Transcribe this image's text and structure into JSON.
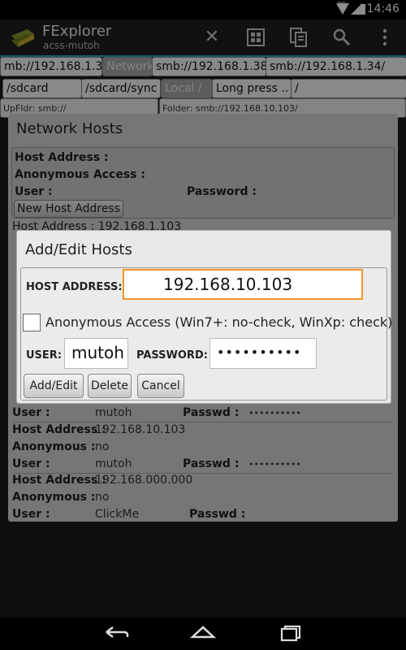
{
  "status": {
    "time": "14:46",
    "network": "3G"
  },
  "app": {
    "title": "FExplorer",
    "subtitle": "acss-mutoh"
  },
  "toolbar_icons": [
    "close-icon",
    "grid-icon",
    "copy-icon",
    "search-icon",
    "overflow-menu-icon"
  ],
  "tabs_row1": [
    {
      "label": "mb://192.168.1.34/"
    },
    {
      "label": "Network"
    },
    {
      "label": "smb://192.168.1.38/"
    },
    {
      "label": "smb://192.168.1.34/"
    }
  ],
  "tabs_row2": [
    {
      "label": "/sdcard"
    },
    {
      "label": "/sdcard/sync"
    },
    {
      "label": "Local /"
    },
    {
      "label": "Long press .."
    },
    {
      "label": "/"
    }
  ],
  "paths": {
    "up": "UpFldr: smb://",
    "folder": "Folder: smb://192.168.10.103/"
  },
  "network_hosts": {
    "title": "Network Hosts",
    "host_label": "Host Address :",
    "anon_label": "Anonymous Access :",
    "user_label": "User :",
    "password_label": "Password :",
    "new_host_button": "New Host Address",
    "first_host_partial": "Host Address :  192.168.1.103",
    "rows": [
      {
        "user_label": "User :",
        "user": "mutoh",
        "pass_label": "Passwd :",
        "pass": "••••••••••"
      },
      {
        "host_label": "Host Address :",
        "host": "192.168.10.103",
        "anon_label": "Anonymous :",
        "anon": "no",
        "user_label": "User :",
        "user": "mutoh",
        "pass_label": "Passwd :",
        "pass": "••••••••••"
      },
      {
        "host_label": "Host Address :",
        "host": "192.168.000.000",
        "anon_label": "Anonymous :",
        "anon": "no",
        "user_label": "User :",
        "user": "ClickMe",
        "pass_label": "Passwd :",
        "pass": ""
      }
    ]
  },
  "edit_dialog": {
    "title": "Add/Edit Hosts",
    "host_label": "HOST ADDRESS:",
    "host_value": "192.168.10.103",
    "anon_checked": false,
    "anon_label": "Anonymous Access (Win7+: no-check, WinXp: check)",
    "user_label": "USER:",
    "user_value": "mutoh",
    "password_label": "PASSWORD:",
    "password_value": "••••••••••",
    "buttons": {
      "add_edit": "Add/Edit",
      "delete": "Delete",
      "cancel": "Cancel"
    }
  },
  "nav": {
    "back": "back-icon",
    "home": "home-icon",
    "recents": "recents-icon"
  },
  "colors": {
    "accent": "#2aa7c9",
    "focus": "#f0962b"
  }
}
